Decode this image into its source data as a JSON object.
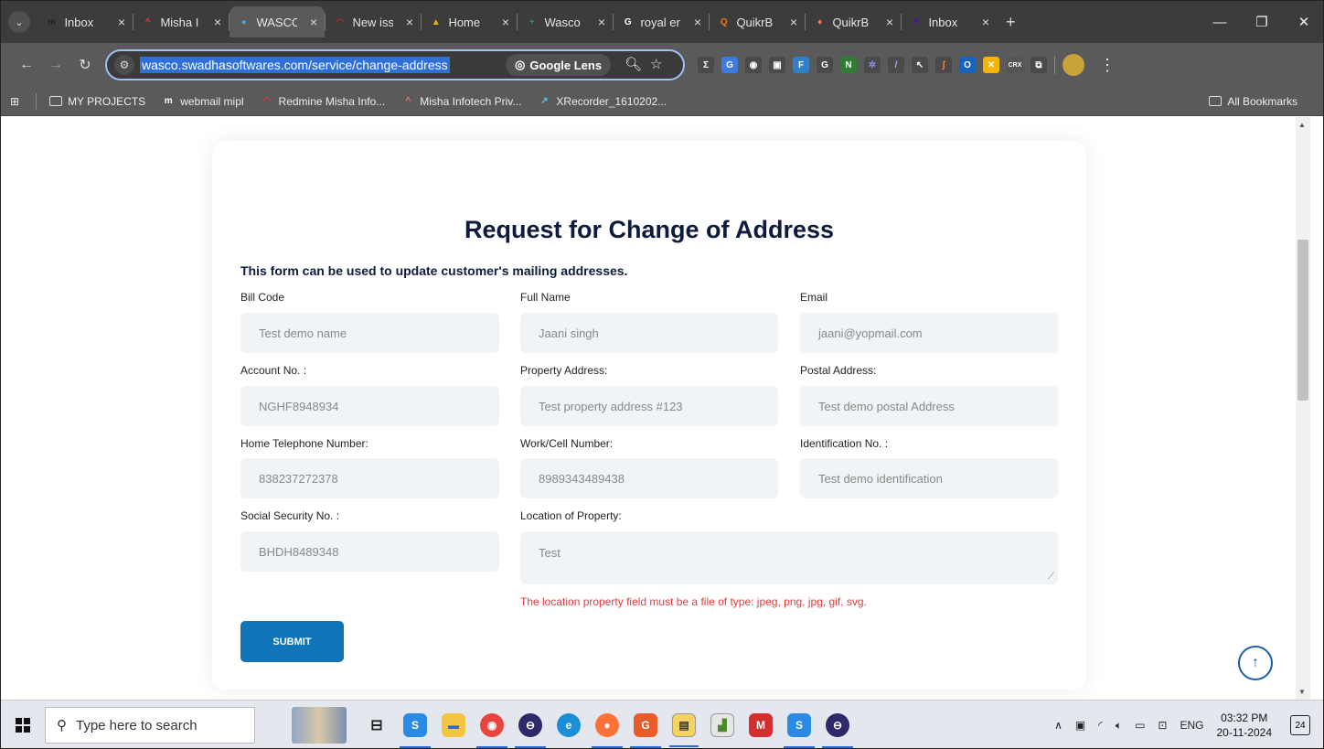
{
  "browser": {
    "tabs": [
      {
        "label": "Inbox",
        "icon": "mail-icon",
        "color": "#222222",
        "glyph": "m",
        "active": false
      },
      {
        "label": "Misha I",
        "icon": "misha-icon",
        "color": "#e03a3a",
        "glyph": "^",
        "active": false
      },
      {
        "label": "WASCO",
        "icon": "water-drop-icon",
        "color": "#4a9fd8",
        "glyph": "●",
        "active": true
      },
      {
        "label": "New iss",
        "icon": "redmine-icon",
        "color": "#c62828",
        "glyph": "◠",
        "active": false
      },
      {
        "label": "Home",
        "icon": "drive-icon",
        "color": "#f4b400",
        "glyph": "▲",
        "active": false
      },
      {
        "label": "Wasco",
        "icon": "sheets-icon",
        "color": "#0f9d58",
        "glyph": "+",
        "active": false
      },
      {
        "label": "royal er",
        "icon": "google-icon",
        "color": "#ffffff",
        "glyph": "G",
        "active": false
      },
      {
        "label": "QuikrB",
        "icon": "quikr-icon",
        "color": "#f57c00",
        "glyph": "Q",
        "active": false
      },
      {
        "label": "QuikrB",
        "icon": "fire-icon",
        "color": "#ff7043",
        "glyph": "♦",
        "active": false
      },
      {
        "label": "Inbox",
        "icon": "yahoo-icon",
        "color": "#6001d2",
        "glyph": "Y",
        "active": false
      }
    ],
    "url": "wasco.swadhasoftwares.com/service/change-address",
    "lens_label": "Google Lens",
    "bookmarks": [
      {
        "label": "MY PROJECTS",
        "icon": "folder-icon"
      },
      {
        "label": "webmail mipl",
        "icon": "mail-icon"
      },
      {
        "label": "Redmine Misha Info...",
        "icon": "redmine-icon"
      },
      {
        "label": "Misha Infotech Priv...",
        "icon": "misha-icon"
      },
      {
        "label": "XRecorder_1610202...",
        "icon": "xrecorder-icon"
      }
    ],
    "all_bookmarks": "All Bookmarks"
  },
  "form": {
    "title": "Request for Change of Address",
    "subtitle": "This form can be used to update customer's mailing addresses.",
    "fields": {
      "bill_code": {
        "label": "Bill Code",
        "value": "Test demo name"
      },
      "full_name": {
        "label": "Full Name",
        "value": "Jaani singh"
      },
      "email": {
        "label": "Email",
        "value": "jaani@yopmail.com"
      },
      "account_no": {
        "label": "Account No. :",
        "value": "NGHF8948934"
      },
      "property_address": {
        "label": "Property Address:",
        "value": "Test property address #123"
      },
      "postal_address": {
        "label": "Postal Address:",
        "value": "Test demo postal Address"
      },
      "home_phone": {
        "label": "Home Telephone Number:",
        "value": "838237272378"
      },
      "work_cell": {
        "label": "Work/Cell Number:",
        "value": "8989343489438"
      },
      "identification": {
        "label": "Identification No. :",
        "value": "Test demo identification"
      },
      "ssn": {
        "label": "Social Security No. :",
        "value": "BHDH8489348"
      },
      "location": {
        "label": "Location of Property:",
        "value": "Test"
      }
    },
    "error": "The location property field must be a file of type: jpeg, png, jpg, gif, svg.",
    "submit_label": "SUBMIT"
  },
  "taskbar": {
    "search_placeholder": "Type here to search",
    "language": "ENG",
    "time": "03:32 PM",
    "date": "20-11-2024",
    "notifications": "24"
  },
  "colors": {
    "title": "#0d1b3e",
    "submit": "#0f75b8",
    "error": "#e03a3a",
    "input_bg": "#f1f4f7"
  }
}
